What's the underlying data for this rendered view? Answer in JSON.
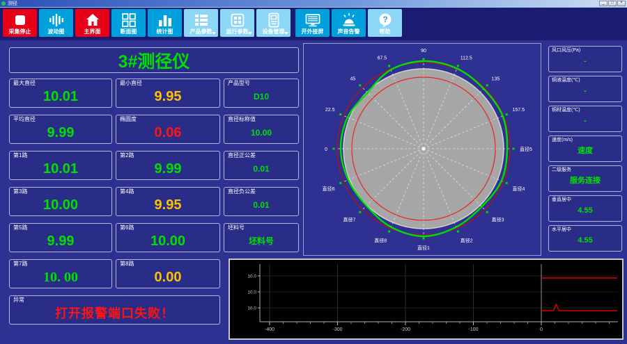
{
  "window": {
    "title": "测径",
    "controls": [
      "_",
      "□",
      "×"
    ]
  },
  "toolbar": {
    "buttons": [
      {
        "label": "采集停止",
        "style": "red",
        "icon": "stop-icon"
      },
      {
        "label": "波动图",
        "style": "blue",
        "icon": "waveform-icon"
      },
      {
        "label": "主界面",
        "style": "red",
        "icon": "home-icon"
      },
      {
        "label": "断面图",
        "style": "blue",
        "icon": "section-view-icon"
      },
      {
        "label": "统计图",
        "style": "blue",
        "icon": "bar-chart-icon"
      },
      {
        "label": "产品参数",
        "style": "light",
        "icon": "product-params-icon",
        "dropdown": true
      },
      {
        "label": "运行参数",
        "style": "light",
        "icon": "run-params-icon",
        "dropdown": true
      },
      {
        "label": "设备管理",
        "style": "light",
        "icon": "device-manage-icon",
        "dropdown": true
      },
      {
        "label": "开外接屏",
        "style": "blue",
        "icon": "external-screen-icon"
      },
      {
        "label": "声音告警",
        "style": "blue",
        "icon": "sound-alarm-icon"
      },
      {
        "label": "帮助",
        "style": "light",
        "icon": "help-icon"
      }
    ]
  },
  "left_panel": {
    "title": "3#测径仪",
    "cards": [
      {
        "label": "最大直径",
        "value": "10.01",
        "color": "green"
      },
      {
        "label": "最小直径",
        "value": "9.95",
        "color": "yellow"
      },
      {
        "label": "产品型号",
        "value": "D10",
        "color": "green",
        "small": true
      },
      {
        "label": "平均直径",
        "value": "9.99",
        "color": "green"
      },
      {
        "label": "椭圆度",
        "value": "0.06",
        "color": "red"
      },
      {
        "label": "直径标称值",
        "value": "10.00",
        "color": "green",
        "small": true
      },
      {
        "label": "第1路",
        "value": "10.01",
        "color": "green"
      },
      {
        "label": "第2路",
        "value": "9.99",
        "color": "green"
      },
      {
        "label": "直径正公差",
        "value": "0.01",
        "color": "green",
        "small": true
      },
      {
        "label": "第3路",
        "value": "10.00",
        "color": "green"
      },
      {
        "label": "第4路",
        "value": "9.95",
        "color": "yellow"
      },
      {
        "label": "直径负公差",
        "value": "0.01",
        "color": "green",
        "small": true
      },
      {
        "label": "第5路",
        "value": "9.99",
        "color": "green"
      },
      {
        "label": "第6路",
        "value": "10.00",
        "color": "green"
      },
      {
        "label": "坯料号",
        "value": "坯料号",
        "color": "green",
        "small": true
      },
      {
        "label": "第7路",
        "value": "10. 00",
        "color": "green",
        "serif": true
      },
      {
        "label": "第8路",
        "value": "0.00",
        "color": "yellow"
      },
      {
        "label": "异常",
        "value": "打开报警端口失败！",
        "color": "red",
        "alarm": true
      }
    ]
  },
  "right_panel": {
    "cards": [
      {
        "label": "风口风压(Pa)",
        "value": "-"
      },
      {
        "label": "铜液温度(℃)",
        "value": "-"
      },
      {
        "label": "铜材温度(℃)",
        "value": "-"
      },
      {
        "label": "速度(m/s)",
        "value": "速度"
      },
      {
        "label": "二级服务",
        "value": "服务连接"
      },
      {
        "label": "垂直居中",
        "value": "4.55"
      },
      {
        "label": "水平居中",
        "value": "4.55"
      }
    ]
  },
  "polar": {
    "type": "polar-profile",
    "angle_labels": [
      {
        "text": "直径5",
        "angle": 0
      },
      {
        "text": "157.5",
        "angle": 22.5
      },
      {
        "text": "135",
        "angle": 45
      },
      {
        "text": "112.5",
        "angle": 67.5
      },
      {
        "text": "90",
        "angle": 90
      },
      {
        "text": "67.5",
        "angle": 112.5
      },
      {
        "text": "45",
        "angle": 135
      },
      {
        "text": "22.5",
        "angle": 157.5
      },
      {
        "text": "0",
        "angle": 180
      },
      {
        "text": "直径6",
        "angle": 202.5
      },
      {
        "text": "直径7",
        "angle": 225
      },
      {
        "text": "直径8",
        "angle": 247.5
      },
      {
        "text": "直径1",
        "angle": 270
      },
      {
        "text": "直径2",
        "angle": 292.5
      },
      {
        "text": "直径3",
        "angle": 315
      },
      {
        "text": "直径4",
        "angle": 337.5
      }
    ],
    "profile_radii": [
      120,
      123,
      122,
      125,
      126,
      123,
      114,
      118,
      119,
      117,
      116,
      122,
      126,
      122,
      118,
      121
    ],
    "nominal_radius": 115,
    "tolerance_inner_radius": 103,
    "tolerance_outer_radius": 124,
    "colors": {
      "body": "#a6a6a6",
      "inner": "#ee2222",
      "outer": "#9a1830",
      "profile": "#00dd00"
    }
  },
  "bottom_chart": {
    "type": "line",
    "x_ticks": [
      "-400",
      "-300",
      "-200",
      "-100",
      "0"
    ],
    "x_tick_values": [
      -400,
      -300,
      -200,
      -100,
      0
    ],
    "x_range": [
      -445,
      112
    ],
    "y_tick_labels": [
      "10.0",
      "10.0",
      "10.0"
    ],
    "red_segments": [
      {
        "level": 0,
        "x_from": 0,
        "x_to": 112,
        "spike_x": null
      },
      {
        "level": 2,
        "x_from": 0,
        "x_to": 112,
        "spike_x": 22
      }
    ],
    "line_color": "#dd0000"
  }
}
